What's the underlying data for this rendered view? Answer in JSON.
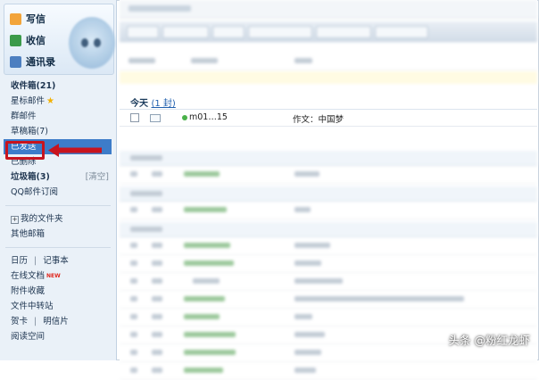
{
  "sidebar": {
    "quick": [
      {
        "label": "写信",
        "icon": "pencil-icon"
      },
      {
        "label": "收信",
        "icon": "inbox-icon"
      },
      {
        "label": "通讯录",
        "icon": "contacts-icon"
      }
    ],
    "inbox": "收件箱(21)",
    "starred": "星标邮件",
    "group": "群邮件",
    "drafts": "草稿箱(7)",
    "sent": "已发送",
    "deleted": "已删除",
    "junk": "垃圾箱(3)",
    "junk_clear": "[清空]",
    "subscriptions": "QQ邮件订阅",
    "my_folders": "我的文件夹",
    "other": "其他邮箱",
    "calendar": "日历",
    "notes": "记事本",
    "online_docs": "在线文档",
    "new_badge": "NEW",
    "attachments": "附件收藏",
    "transfer": "文件中转站",
    "cards": "贺卡",
    "postcards": "明信片",
    "reading": "阅读空间",
    "divider": "|"
  },
  "main": {
    "today_label": "今天",
    "today_count": "(1 封)",
    "first_mail": {
      "sender": "m01…15",
      "subject": "作文：中国梦"
    }
  },
  "watermark": "头条 @粉红龙虾",
  "colors": {
    "highlight": "#c8141e",
    "selected": "#3d7cc9"
  }
}
